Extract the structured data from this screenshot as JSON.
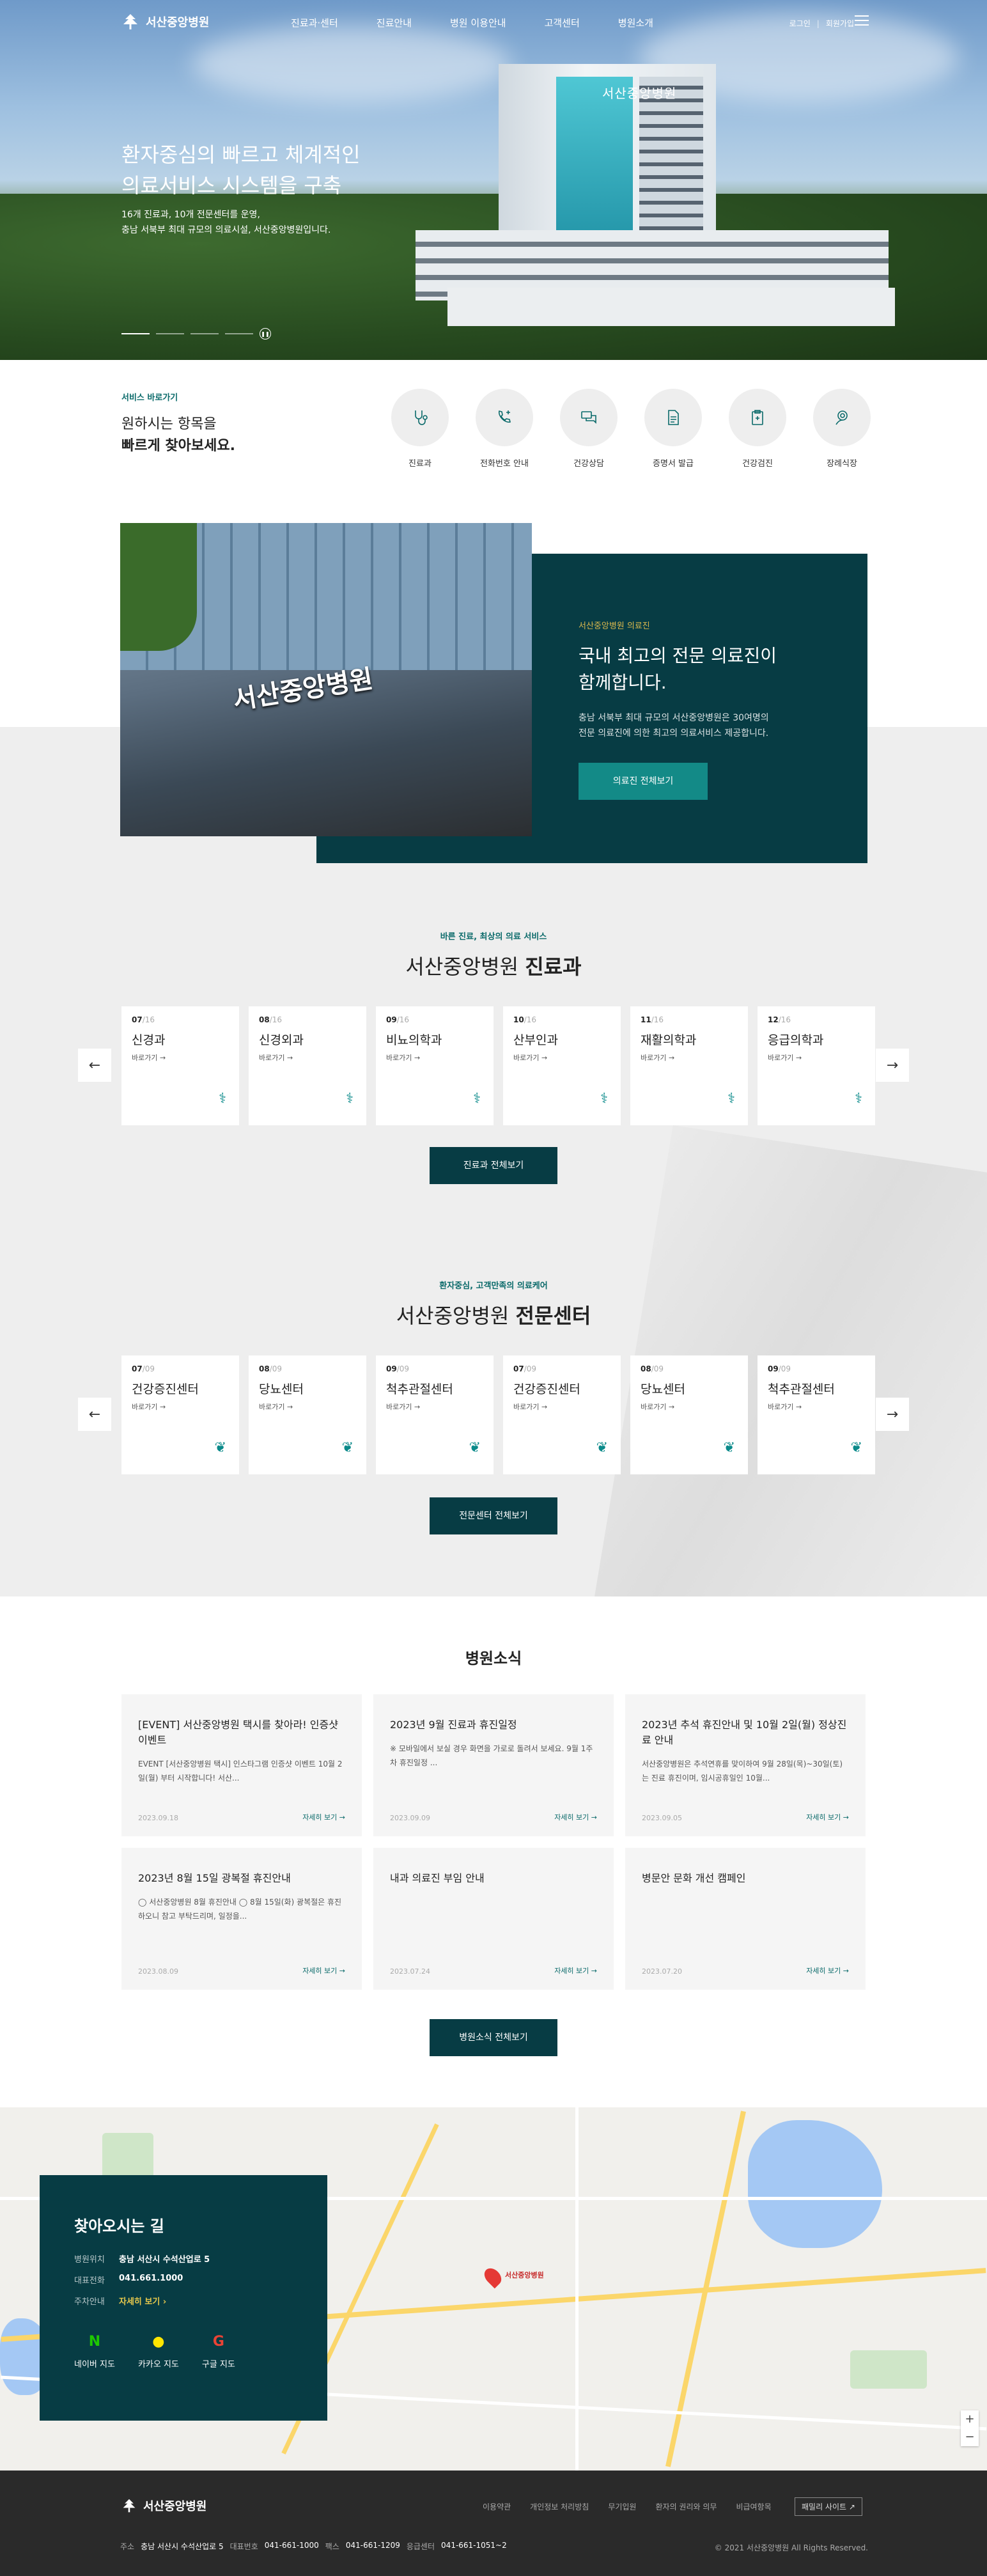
{
  "header": {
    "logo_text": "서산중앙병원",
    "nav": [
      "진료과·센터",
      "진료안내",
      "병원 이용안내",
      "고객센터",
      "병원소개"
    ],
    "util": [
      "로그인",
      "회원가입"
    ]
  },
  "hero": {
    "title": "환자중심의 빠르고 체계적인\n의료서비스 시스템을 구축",
    "desc": "16개 진료과, 10개 전문센터를 운영,\n충남 서북부 최대 규모의 의료시설, 서산중앙병원입니다.",
    "building_sign": "서산중앙병원"
  },
  "quick": {
    "label": "서비스 바로가기",
    "title_line1": "원하시는 항목을",
    "title_line2": "빠르게 찾아보세요.",
    "items": [
      {
        "label": "진료과",
        "icon": "stethoscope-icon"
      },
      {
        "label": "전화번호 안내",
        "icon": "phone-icon"
      },
      {
        "label": "건강상담",
        "icon": "chat-icon"
      },
      {
        "label": "증명서 발급",
        "icon": "document-icon"
      },
      {
        "label": "건강검진",
        "icon": "clipboard-icon"
      },
      {
        "label": "장례식장",
        "icon": "funeral-icon"
      }
    ]
  },
  "doctors": {
    "tag": "서산중앙병원 의료진",
    "title": "국내 최고의 전문 의료진이\n함께합니다.",
    "desc": "충남 서북부 최대 규모의 서산중앙병원은 30여명의\n전문 의료진에 의한 최고의 의료서비스 제공합니다.",
    "button": "의료진 전체보기",
    "image_sign": "서산중앙병원"
  },
  "departments": {
    "sub": "바른 진료, 최상의 의료 서비스",
    "title_prefix": "서산중앙병원",
    "title_bold": "진료과",
    "items": [
      {
        "num": "07",
        "total": "/16",
        "name": "신경과"
      },
      {
        "num": "08",
        "total": "/16",
        "name": "신경외과"
      },
      {
        "num": "09",
        "total": "/16",
        "name": "비뇨의학과"
      },
      {
        "num": "10",
        "total": "/16",
        "name": "산부인과"
      },
      {
        "num": "11",
        "total": "/16",
        "name": "재활의학과"
      },
      {
        "num": "12",
        "total": "/16",
        "name": "응급의학과"
      }
    ],
    "go_label": "바로가기 →",
    "button": "진료과 전체보기"
  },
  "centers": {
    "sub": "환자중심, 고객만족의 의료케어",
    "title_prefix": "서산중앙병원",
    "title_bold": "전문센터",
    "items": [
      {
        "num": "07",
        "total": "/09",
        "name": "건강증진센터"
      },
      {
        "num": "08",
        "total": "/09",
        "name": "당뇨센터"
      },
      {
        "num": "09",
        "total": "/09",
        "name": "척추관절센터"
      },
      {
        "num": "07",
        "total": "/09",
        "name": "건강증진센터"
      },
      {
        "num": "08",
        "total": "/09",
        "name": "당뇨센터"
      },
      {
        "num": "09",
        "total": "/09",
        "name": "척추관절센터"
      }
    ],
    "go_label": "바로가기 →",
    "button": "전문센터 전체보기"
  },
  "news": {
    "title": "병원소식",
    "more_label": "자세히 보기 →",
    "items": [
      {
        "title": "[EVENT] 서산중앙병원 택시를 찾아라! 인증샷 이벤트",
        "desc": "EVENT [서산중앙병원 택시] 인스타그램 인증샷 이벤트 10월 2일(월) 부터 시작합니다! 서산...",
        "date": "2023.09.18"
      },
      {
        "title": "2023년 9월 진료과 휴진일정",
        "desc": "※ 모바일에서 보실 경우 화면을 가로로 돌려서 보세요. 9월 1주차 휴진일정 ...",
        "date": "2023.09.09"
      },
      {
        "title": "2023년 추석 휴진안내 및 10월 2일(월) 정상진료 안내",
        "desc": "서산중앙병원은 추석연휴를 맞이하여 9월 28일(목)~30일(토)는 진료 휴진이며, 임시공휴일인 10월...",
        "date": "2023.09.05"
      },
      {
        "title": "2023년 8월 15일 광복절 휴진안내",
        "desc": "◯ 서산중앙병원 8월 휴진안내 ◯ 8월 15일(화) 광복절은 휴진하오니 참고 부탁드리며, 일정을...",
        "date": "2023.08.09"
      },
      {
        "title": "내과 의료진 부임 안내",
        "desc": "",
        "date": "2023.07.24"
      },
      {
        "title": "병문안 문화 개선 캠페인",
        "desc": "",
        "date": "2023.07.20"
      }
    ],
    "button": "병원소식 전체보기"
  },
  "location": {
    "title": "찾아오시는 길",
    "rows": [
      {
        "k": "병원위치",
        "v": "충남 서산시 수석산업로 5"
      },
      {
        "k": "대표전화",
        "v": "041.661.1000"
      },
      {
        "k": "주차안내",
        "v": "자세히 보기 ›"
      }
    ],
    "links": [
      {
        "icon": "N",
        "label": "네이버 지도"
      },
      {
        "icon": "●",
        "label": "카카오 지도"
      },
      {
        "icon": "G",
        "label": "구글 지도"
      }
    ],
    "marker_label": "서산중앙병원"
  },
  "footer": {
    "logo_text": "서산중앙병원",
    "links": [
      "이용약관",
      "개인정보 처리방침",
      "무기입원",
      "환자의 권리와 의무",
      "비급여항목"
    ],
    "family_site": "패밀리 사이트 ↗",
    "info": [
      {
        "k": "주소",
        "v": "충남 서산시 수석산업로 5"
      },
      {
        "k": "대표번호",
        "v": "041-661-1000"
      },
      {
        "k": "팩스",
        "v": "041-661-1209"
      },
      {
        "k": "응급센터",
        "v": "041-661-1051~2"
      }
    ],
    "copyright": "© 2021 서산중앙병원 All Rights Reserved."
  },
  "colors": {
    "primary": "#073c44",
    "mint": "#138a87",
    "accent": "#0a6a6a"
  }
}
